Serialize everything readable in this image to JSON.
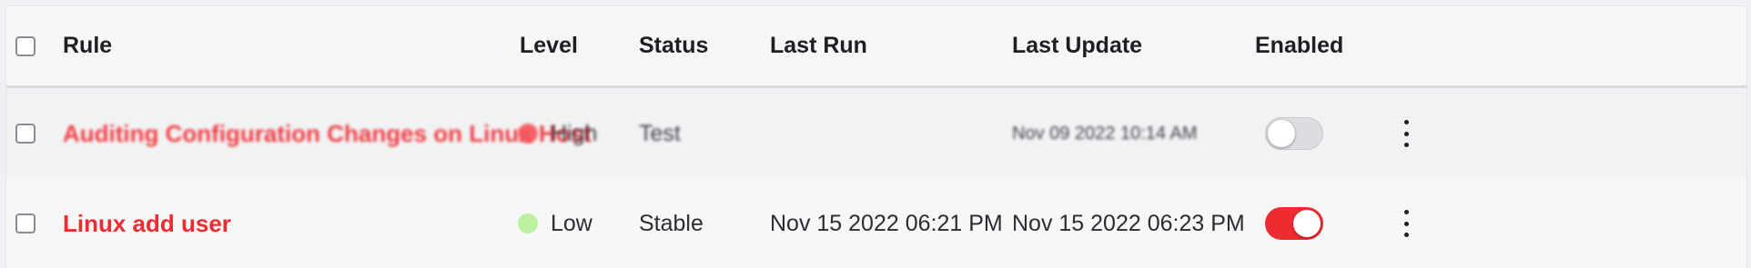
{
  "table": {
    "columns": {
      "rule": "Rule",
      "level": "Level",
      "status": "Status",
      "last_run": "Last Run",
      "last_update": "Last Update",
      "enabled": "Enabled"
    },
    "rows": [
      {
        "rule": "Auditing Configuration Changes on Linux Host",
        "level": "High",
        "level_color": "#f5545a",
        "status": "Test",
        "last_run": "",
        "last_update": "Nov 09 2022 10:14 AM",
        "enabled": false
      },
      {
        "rule": "Linux add user",
        "level": "Low",
        "level_color": "#bdf0a0",
        "status": "Stable",
        "last_run": "Nov 15 2022 06:21 PM",
        "last_update": "Nov 15 2022 06:23 PM",
        "enabled": true
      }
    ]
  },
  "colors": {
    "accent": "#ee2b31",
    "toggle_off": "#dcdde1"
  },
  "icons": {
    "row_menu": "kebab-menu-icon"
  }
}
